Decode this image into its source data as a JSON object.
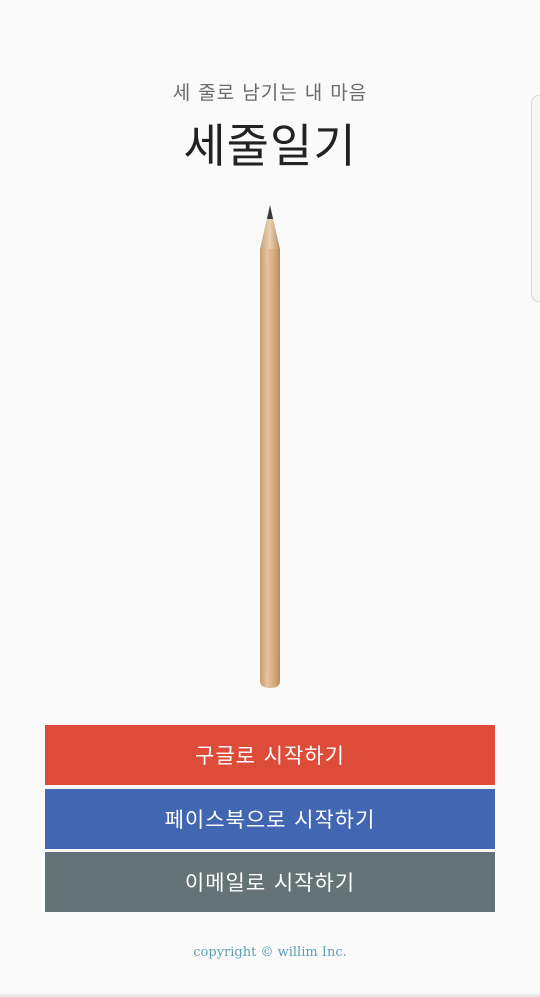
{
  "header": {
    "subtitle": "세 줄로 남기는 내 마음",
    "title": "세줄일기"
  },
  "illustration": {
    "icon": "pencil-icon",
    "wood_color": "#d9b58f",
    "graphite_color": "#3a3a3a"
  },
  "buttons": {
    "google_label": "구글로 시작하기",
    "facebook_label": "페이스북으로 시작하기",
    "email_label": "이메일로 시작하기",
    "google_color": "#dd4b39",
    "facebook_color": "#4267b2",
    "email_color": "#637378"
  },
  "footer": {
    "copyright": "copyright © willim Inc."
  }
}
